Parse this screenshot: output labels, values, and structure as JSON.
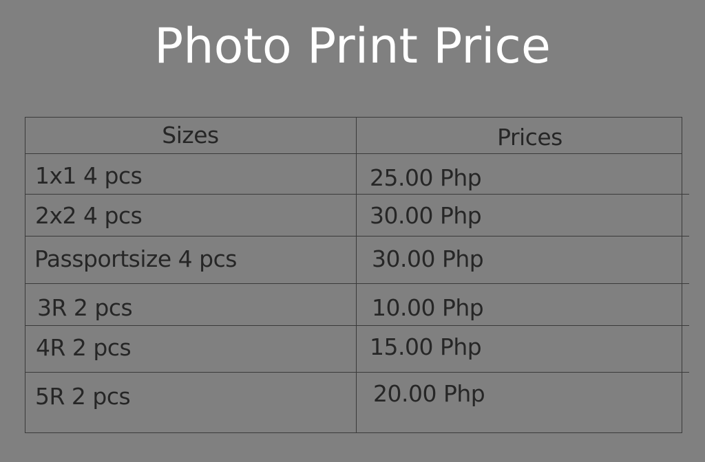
{
  "title": "Photo Print Price",
  "table": {
    "headers": [
      "Sizes",
      "Prices"
    ],
    "rows": [
      {
        "size": "1x1 4 pcs",
        "price": "25.00 Php"
      },
      {
        "size": "2x2 4 pcs",
        "price": "30.00 Php"
      },
      {
        "size": "Passportsize 4 pcs",
        "price": "30.00 Php"
      },
      {
        "size": "3R 2 pcs",
        "price": "10.00 Php"
      },
      {
        "size": "4R 2 pcs",
        "price": "15.00 Php"
      },
      {
        "size": "5R 2 pcs",
        "price": "20.00 Php"
      }
    ]
  }
}
